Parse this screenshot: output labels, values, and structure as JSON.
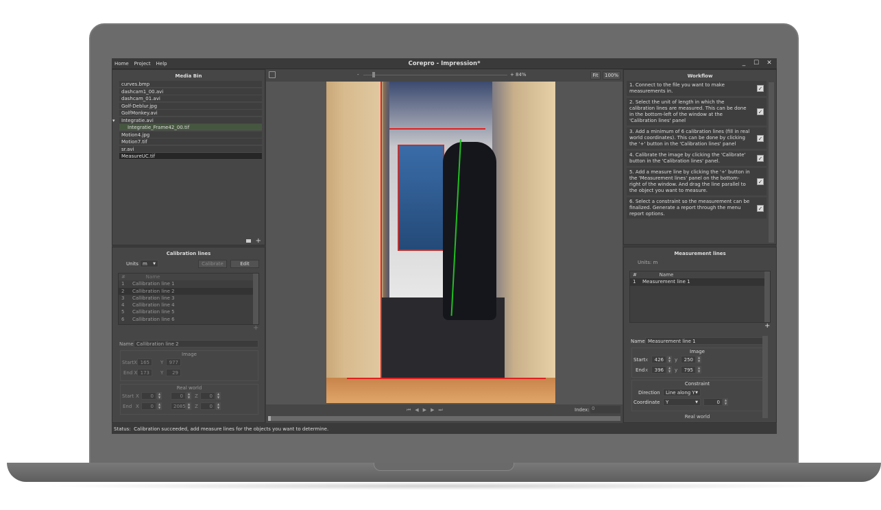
{
  "window": {
    "title": "Corepro - Impression*",
    "minimize": "_",
    "maximize": "☐",
    "close": "✕"
  },
  "menu": [
    "Home",
    "Project",
    "Help"
  ],
  "media_bin": {
    "title": "Media Bin",
    "items": [
      {
        "label": "curves.bmp",
        "level": 0
      },
      {
        "label": "dashcam1_00.avi",
        "level": 0
      },
      {
        "label": "dashcam_01.avi",
        "level": 0
      },
      {
        "label": "Golf-Deblur.jpg",
        "level": 0
      },
      {
        "label": "GolfMonkey.avi",
        "level": 0
      },
      {
        "label": "Integratie.avi",
        "level": 0,
        "expanded": true
      },
      {
        "label": "Integratie_Frame42_00.tif",
        "level": 1,
        "highlighted": true
      },
      {
        "label": "Motion4.jpg",
        "level": 0
      },
      {
        "label": "Motion7.tif",
        "level": 0
      },
      {
        "label": "sr.avi",
        "level": 0
      },
      {
        "label": "MeasureUC.tif",
        "level": 0,
        "selected": true
      }
    ]
  },
  "viewer": {
    "zoom_minus": "-",
    "zoom_plus": "+",
    "zoom_level": "84%",
    "zoom_fraction": 0.06,
    "fit_label": "Fit",
    "actual_label": "100%",
    "index_label": "Index:",
    "index_value": "0",
    "timeline_position": 0
  },
  "calibration": {
    "title": "Calibration lines",
    "units_label": "Units",
    "units_value": "m",
    "calibrate_label": "Calibrate",
    "edit_label": "Edit",
    "columns": [
      "#",
      "Name"
    ],
    "rows": [
      [
        "1",
        "Callibration line 1"
      ],
      [
        "2",
        "Callibration line 2"
      ],
      [
        "3",
        "Callibration line 3"
      ],
      [
        "4",
        "Callibration line 4"
      ],
      [
        "5",
        "Callibration line 5"
      ],
      [
        "6",
        "Callibration line 6"
      ]
    ],
    "selected_row": 1,
    "add": "+",
    "name_label": "Name",
    "name_value": "Callibration line 2",
    "image_title": "Image",
    "start_label": "StartX",
    "end_label": "End X",
    "y_label": "Y",
    "start_x": "165",
    "start_y": "977",
    "end_x": "173",
    "end_y": "29",
    "real_title": "Real world",
    "start": "Start",
    "end": "End",
    "x": "X",
    "z": "Z",
    "rw_start": [
      "0",
      "0",
      "0"
    ],
    "rw_end": [
      "0",
      "2085",
      "0"
    ]
  },
  "workflow": {
    "title": "Workflow",
    "steps": [
      {
        "text": "1.  Connect to the file you want to make measurements in.",
        "checked": true
      },
      {
        "text": "2.  Select the unit of length in which the calibration lines are measured. This can be done in the bottom-left of the window at the 'Calibration lines' panel",
        "checked": true
      },
      {
        "text": "3.  Add a minimum of 6 calibration lines (fill in real world coordinates). This can be done by clicking the '+' button in the 'Calibration lines' panel",
        "checked": true
      },
      {
        "text": "4.  Calibrate the image by clicking the 'Calibrate' button in the 'Calibration lines' panel.",
        "checked": true
      },
      {
        "text": "5.  Add a measure line by clicking the '+' button in the 'Measurement lines' panel on the bottom-right of the window. And drag the line parallel to the object you want to measure.",
        "checked": true
      },
      {
        "text": "6.  Select a constraint so the measurement can be finalized. Generate a report through the menu report options.",
        "checked": true
      }
    ]
  },
  "measurement": {
    "title": "Measurement lines",
    "units": "Units: m",
    "columns": [
      "#",
      "Name"
    ],
    "rows": [
      [
        "1",
        "Measurement line 1"
      ]
    ],
    "add": "+",
    "name_label": "Name",
    "name_value": "Measurement line 1",
    "image_title": "Image",
    "start": "Start",
    "end": "End",
    "x": "x",
    "y": "y",
    "start_x": "426",
    "start_y": "250",
    "end_x": "396",
    "end_y": "795",
    "constraint_title": "Constraint",
    "direction_label": "Direction",
    "direction_value": "Line along Y",
    "coordinate_label": "Coordinate",
    "coordinate_value": "Y",
    "coordinate_number": "0",
    "real_title": "Real world"
  },
  "status": {
    "label": "Status:",
    "text": "Calibration succeeded, add measure lines for the objects you want to determine."
  },
  "colors": {
    "calibration_line": "#e02020",
    "measurement_line": "#20c020"
  }
}
